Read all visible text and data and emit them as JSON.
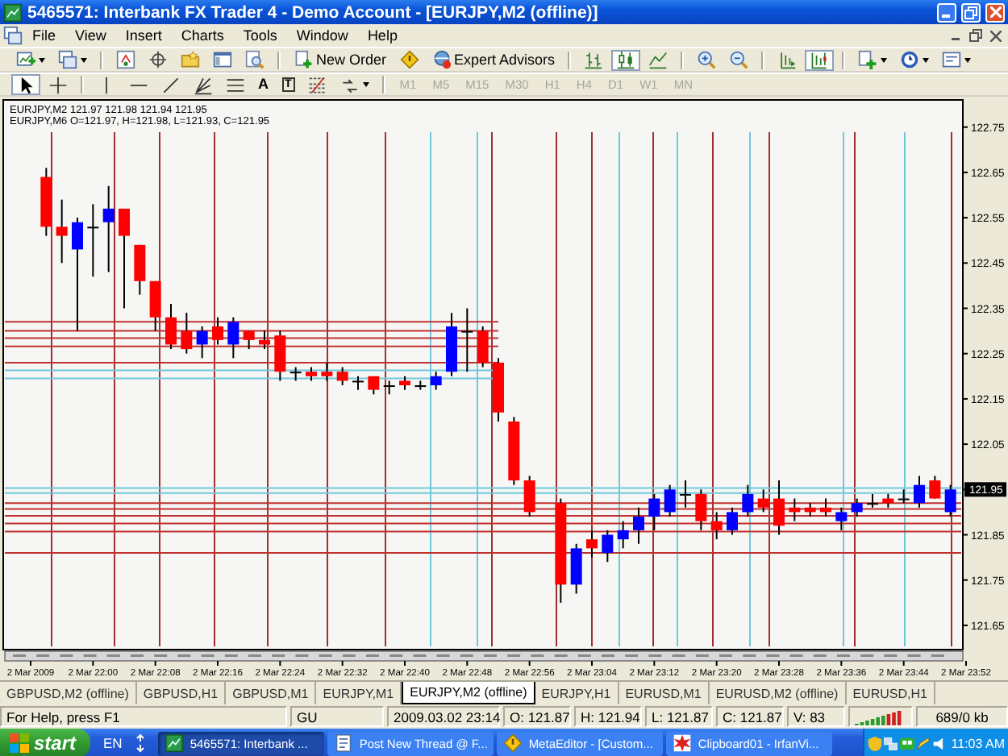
{
  "window": {
    "title": "5465571: Interbank FX Trader 4 - Demo Account - [EURJPY,M2 (offline)]"
  },
  "menu": [
    "File",
    "View",
    "Insert",
    "Charts",
    "Tools",
    "Window",
    "Help"
  ],
  "toolbar_1": [
    [
      {
        "kind": "new-chart",
        "pressed": false,
        "dropdown": true
      },
      {
        "kind": "profiles",
        "pressed": false,
        "dropdown": true
      }
    ],
    [
      {
        "kind": "market-watch",
        "pressed": false
      },
      {
        "kind": "navigator",
        "pressed": false
      },
      {
        "kind": "terminal",
        "pressed": false
      },
      {
        "kind": "data-window",
        "pressed": false
      },
      {
        "kind": "tester",
        "pressed": false
      }
    ],
    [
      {
        "kind": "new-order",
        "pressed": false,
        "label": "New Order"
      },
      {
        "kind": "metaeditor",
        "pressed": false
      },
      {
        "kind": "expert-advisors",
        "pressed": false,
        "label": "Expert Advisors"
      }
    ],
    [
      {
        "kind": "bar-chart",
        "pressed": false
      },
      {
        "kind": "candle-chart",
        "pressed": true
      },
      {
        "kind": "line-chart",
        "pressed": false
      }
    ],
    [
      {
        "kind": "zoom-in",
        "pressed": false
      },
      {
        "kind": "zoom-out",
        "pressed": false
      }
    ],
    [
      {
        "kind": "autoscroll",
        "pressed": false
      },
      {
        "kind": "chart-shift",
        "pressed": true
      }
    ],
    [
      {
        "kind": "indicators",
        "pressed": false,
        "dropdown": true
      },
      {
        "kind": "periods",
        "pressed": false,
        "dropdown": true
      },
      {
        "kind": "templates",
        "pressed": false,
        "dropdown": true
      }
    ]
  ],
  "toolbar_2": [
    [
      {
        "kind": "cursor",
        "pressed": true
      },
      {
        "kind": "crosshair",
        "pressed": false
      }
    ],
    [
      {
        "kind": "vline",
        "pressed": false
      },
      {
        "kind": "hline",
        "pressed": false
      },
      {
        "kind": "trendline",
        "pressed": false
      },
      {
        "kind": "gann",
        "pressed": false
      },
      {
        "kind": "channel",
        "pressed": false
      },
      {
        "kind": "text",
        "pressed": false,
        "glyph": "A"
      },
      {
        "kind": "text-label",
        "pressed": false,
        "glyph": "T"
      },
      {
        "kind": "fibo",
        "pressed": false
      },
      {
        "kind": "arrows",
        "pressed": false,
        "dropdown": true
      }
    ],
    [
      {
        "kind": "timeframe",
        "pressed": false,
        "disabled": true,
        "label": "M1"
      },
      {
        "kind": "timeframe",
        "pressed": false,
        "disabled": true,
        "label": "M5"
      },
      {
        "kind": "timeframe",
        "pressed": false,
        "disabled": true,
        "label": "M15"
      },
      {
        "kind": "timeframe",
        "pressed": false,
        "disabled": true,
        "label": "M30"
      },
      {
        "kind": "timeframe",
        "pressed": false,
        "disabled": true,
        "label": "H1"
      },
      {
        "kind": "timeframe",
        "pressed": false,
        "disabled": true,
        "label": "H4"
      },
      {
        "kind": "timeframe",
        "pressed": false,
        "disabled": true,
        "label": "D1"
      },
      {
        "kind": "timeframe",
        "pressed": false,
        "disabled": true,
        "label": "W1"
      },
      {
        "kind": "timeframe",
        "pressed": false,
        "disabled": true,
        "label": "MN"
      }
    ]
  ],
  "chart": {
    "header_lines": [
      "EURJPY,M2 121.97 121.98 121.94 121.95",
      "EURJPY,M6 O=121.97, H=121.98, L=121.93, C=121.95"
    ],
    "current_price": "121.95",
    "chart_data": {
      "type": "candlestick",
      "grid": true,
      "categories": [
        "2 Mar 2009",
        null,
        null,
        null,
        "2 Mar 22:00",
        null,
        null,
        null,
        "2 Mar 22:08",
        null,
        null,
        null,
        "2 Mar 22:16",
        null,
        null,
        null,
        "2 Mar 22:24",
        null,
        null,
        null,
        "2 Mar 22:32",
        null,
        null,
        null,
        "2 Mar 22:40",
        null,
        null,
        null,
        "2 Mar 22:48",
        null,
        null,
        null,
        "2 Mar 22:56",
        null,
        null,
        null,
        "2 Mar 23:04",
        null,
        null,
        null,
        "2 Mar 23:12",
        null,
        null,
        null,
        "2 Mar 23:20",
        null,
        null,
        null,
        "2 Mar 23:28",
        null,
        null,
        null,
        "2 Mar 23:36",
        null,
        null,
        null,
        "2 Mar 23:44",
        null,
        null,
        null,
        "2 Mar 23:52"
      ],
      "ohlc": [
        null,
        [
          122.64,
          122.66,
          122.51,
          122.53
        ],
        [
          122.53,
          122.59,
          122.45,
          122.51
        ],
        [
          122.48,
          122.55,
          122.3,
          122.54
        ],
        [
          122.53,
          122.58,
          122.42,
          122.53
        ],
        [
          122.54,
          122.62,
          122.43,
          122.57
        ],
        [
          122.57,
          122.57,
          122.35,
          122.51
        ],
        [
          122.49,
          122.49,
          122.38,
          122.41
        ],
        [
          122.41,
          122.41,
          122.3,
          122.33
        ],
        [
          122.33,
          122.36,
          122.26,
          122.27
        ],
        [
          122.3,
          122.34,
          122.25,
          122.26
        ],
        [
          122.27,
          122.31,
          122.24,
          122.3
        ],
        [
          122.31,
          122.33,
          122.27,
          122.28
        ],
        [
          122.27,
          122.33,
          122.24,
          122.32
        ],
        [
          122.3,
          122.3,
          122.26,
          122.28
        ],
        [
          122.28,
          122.3,
          122.26,
          122.27
        ],
        [
          122.29,
          122.3,
          122.19,
          122.21
        ],
        [
          122.21,
          122.22,
          122.19,
          122.21
        ],
        [
          122.21,
          122.22,
          122.19,
          122.2
        ],
        [
          122.21,
          122.23,
          122.19,
          122.2
        ],
        [
          122.21,
          122.22,
          122.18,
          122.19
        ],
        [
          122.19,
          122.2,
          122.17,
          122.19
        ],
        [
          122.2,
          122.2,
          122.16,
          122.17
        ],
        [
          122.18,
          122.19,
          122.16,
          122.18
        ],
        [
          122.19,
          122.2,
          122.17,
          122.18
        ],
        [
          122.18,
          122.19,
          122.17,
          122.18
        ],
        [
          122.18,
          122.21,
          122.17,
          122.2
        ],
        [
          122.21,
          122.34,
          122.2,
          122.31
        ],
        [
          122.3,
          122.35,
          122.21,
          122.3
        ],
        [
          122.3,
          122.31,
          122.22,
          122.23
        ],
        [
          122.23,
          122.24,
          122.1,
          122.12
        ],
        [
          122.1,
          122.11,
          121.96,
          121.97
        ],
        [
          121.97,
          121.98,
          121.89,
          121.9
        ],
        null,
        [
          121.92,
          121.93,
          121.7,
          121.74
        ],
        [
          121.74,
          121.83,
          121.72,
          121.82
        ],
        [
          121.84,
          121.86,
          121.8,
          121.82
        ],
        [
          121.81,
          121.86,
          121.79,
          121.85
        ],
        [
          121.84,
          121.88,
          121.82,
          121.86
        ],
        [
          121.86,
          121.91,
          121.83,
          121.89
        ],
        [
          121.89,
          121.94,
          121.86,
          121.93
        ],
        [
          121.9,
          121.96,
          121.89,
          121.95
        ],
        [
          121.94,
          121.97,
          121.91,
          121.94
        ],
        [
          121.94,
          121.95,
          121.86,
          121.88
        ],
        [
          121.88,
          121.9,
          121.84,
          121.86
        ],
        [
          121.86,
          121.91,
          121.85,
          121.9
        ],
        [
          121.9,
          121.96,
          121.89,
          121.94
        ],
        [
          121.93,
          121.95,
          121.9,
          121.91
        ],
        [
          121.93,
          121.97,
          121.85,
          121.87
        ],
        [
          121.91,
          121.93,
          121.88,
          121.9
        ],
        [
          121.91,
          121.92,
          121.89,
          121.9
        ],
        [
          121.91,
          121.93,
          121.89,
          121.9
        ],
        [
          121.88,
          121.91,
          121.86,
          121.9
        ],
        [
          121.9,
          121.93,
          121.89,
          121.92
        ],
        [
          121.92,
          121.94,
          121.91,
          121.92
        ],
        [
          121.93,
          121.94,
          121.91,
          121.92
        ],
        [
          121.93,
          121.95,
          121.92,
          121.93
        ],
        [
          121.92,
          121.98,
          121.91,
          121.96
        ],
        [
          121.97,
          121.98,
          121.93,
          121.93
        ],
        [
          121.9,
          121.96,
          121.89,
          121.95
        ],
        null
      ],
      "ylim": [
        121.6,
        122.81
      ],
      "yticks": [
        121.65,
        121.75,
        121.85,
        121.95,
        122.05,
        122.15,
        122.25,
        122.35,
        122.45,
        122.55,
        122.65,
        122.75
      ],
      "ref_lines": [
        {
          "axis": "y",
          "value": 122.32,
          "color": "#c03030"
        },
        {
          "axis": "y",
          "value": 122.3,
          "color": "#c03030"
        },
        {
          "axis": "y",
          "value": 122.284,
          "color": "#c03030"
        },
        {
          "axis": "y",
          "value": 122.266,
          "color": "#c03030"
        },
        {
          "axis": "y",
          "value": 122.23,
          "color": "#c03030"
        },
        {
          "axis": "y",
          "value": 122.213,
          "color": "#70c8dc"
        },
        {
          "axis": "y",
          "value": 122.195,
          "color": "#70c8dc"
        },
        {
          "axis": "y",
          "value": 121.953,
          "color": "#70c8dc"
        },
        {
          "axis": "y",
          "value": 121.942,
          "color": "#70c8dc"
        },
        {
          "axis": "y",
          "value": 121.92,
          "color": "#c03030"
        },
        {
          "axis": "y",
          "value": 121.907,
          "color": "#c03030"
        },
        {
          "axis": "y",
          "value": 121.892,
          "color": "#c03030"
        },
        {
          "axis": "y",
          "value": 121.875,
          "color": "#c03030"
        },
        {
          "axis": "y",
          "value": 121.857,
          "color": "#c03030"
        },
        {
          "axis": "y",
          "value": 121.81,
          "color": "#c03030"
        }
      ]
    }
  },
  "chart_tabs": [
    {
      "label": "GBPUSD,M2 (offline)",
      "selected": false
    },
    {
      "label": "GBPUSD,H1",
      "selected": false
    },
    {
      "label": "GBPUSD,M1",
      "selected": false
    },
    {
      "label": "EURJPY,M1",
      "selected": false
    },
    {
      "label": "EURJPY,M2 (offline)",
      "selected": true
    },
    {
      "label": "EURJPY,H1",
      "selected": false
    },
    {
      "label": "EURUSD,M1",
      "selected": false
    },
    {
      "label": "EURUSD,M2 (offline)",
      "selected": false
    },
    {
      "label": "EURUSD,H1",
      "selected": false
    }
  ],
  "status_bar": {
    "fields": [
      "For Help, press F1",
      "GU",
      "2009.03.02 23:14",
      "O: 121.87",
      "H: 121.94",
      "L: 121.87",
      "C: 121.87",
      "V: 83"
    ],
    "traffic": "689/0 kb"
  },
  "taskbar": {
    "start": "start",
    "language": "EN",
    "tasks": [
      {
        "kind": "terminal",
        "label": "5465571: Interbank ...",
        "selected": true
      },
      {
        "kind": "browser",
        "label": "Post New Thread @ F...",
        "selected": false
      },
      {
        "kind": "metaeditor",
        "label": "MetaEditor - [Custom...",
        "selected": false
      },
      {
        "kind": "viewer",
        "label": "Clipboard01 - IrfanVi...",
        "selected": false
      }
    ],
    "clock": "11:03 AM"
  }
}
